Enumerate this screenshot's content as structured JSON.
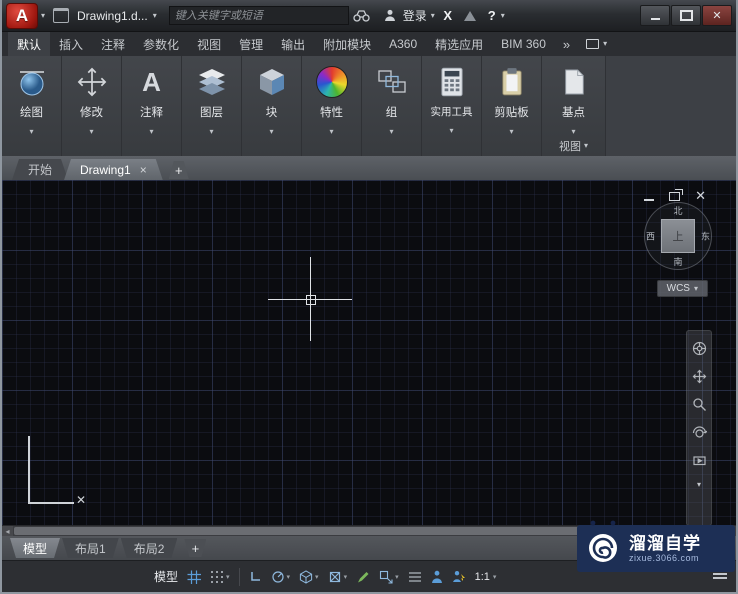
{
  "glyphs": {
    "dropdown": "▾",
    "overflow": "»",
    "plus": "+",
    "close": "✕",
    "close_small": "×",
    "left_arrow": "◂"
  },
  "titlebar": {
    "logo_letter": "A",
    "title": "Drawing1.d...",
    "search_placeholder": "键入关键字或短语",
    "login_label": "登录",
    "exchange_label": "X",
    "help_label": "?"
  },
  "icons": {
    "annotate_letter": "A"
  },
  "ribbon": {
    "tabs": [
      {
        "label": "默认"
      },
      {
        "label": "插入"
      },
      {
        "label": "注释"
      },
      {
        "label": "参数化"
      },
      {
        "label": "视图"
      },
      {
        "label": "管理"
      },
      {
        "label": "输出"
      },
      {
        "label": "附加模块"
      },
      {
        "label": "A360"
      },
      {
        "label": "精选应用"
      },
      {
        "label": "BIM 360"
      }
    ],
    "panels": [
      {
        "label": "绘图"
      },
      {
        "label": "修改"
      },
      {
        "label": "注释"
      },
      {
        "label": "图层"
      },
      {
        "label": "块"
      },
      {
        "label": "特性"
      },
      {
        "label": "组"
      },
      {
        "label": "实用工具"
      },
      {
        "label": "剪贴板"
      },
      {
        "label": "基点",
        "panel_title": "视图"
      }
    ]
  },
  "file_tabs": {
    "start": "开始",
    "drawing": "Drawing1"
  },
  "viewport": {
    "viewcube": {
      "north": "北",
      "south": "南",
      "west": "西",
      "east": "东",
      "top_face": "上"
    },
    "wcs_label": "WCS",
    "ucs_x_label": "✕"
  },
  "layout_bar": {
    "model": "模型",
    "layout1": "布局1",
    "layout2": "布局2"
  },
  "status_bar": {
    "model_label": "模型",
    "scale_label": "1:1"
  },
  "watermark": {
    "title": "溜溜自学",
    "url": "zixue.3066.com"
  }
}
